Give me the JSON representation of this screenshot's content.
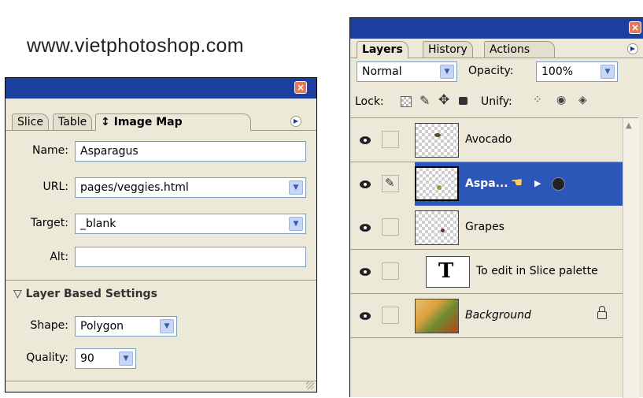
{
  "caption": "www.vietphotoshop.com",
  "image_map_panel": {
    "tabs": [
      "Slice",
      "Table",
      "↕ Image Map"
    ],
    "fields": {
      "name_label": "Name:",
      "name_value": "Asparagus",
      "url_label": "URL:",
      "url_value": "pages/veggies.html",
      "target_label": "Target:",
      "target_value": "_blank",
      "alt_label": "Alt:",
      "alt_value": ""
    },
    "section_title": "▽ Layer Based Settings",
    "shape_label": "Shape:",
    "shape_value": "Polygon",
    "quality_label": "Quality:",
    "quality_value": "90"
  },
  "layers_panel": {
    "tabs": [
      "Layers",
      "History",
      "Actions"
    ],
    "blend_mode": "Normal",
    "opacity_label": "Opacity:",
    "opacity_value": "100%",
    "lock_label": "Lock:",
    "unify_label": "Unify:",
    "layers": [
      {
        "name": "Avocado",
        "selected": false
      },
      {
        "name": "Aspa...",
        "selected": true
      },
      {
        "name": "Grapes",
        "selected": false
      },
      {
        "name": "To edit in Slice palette",
        "selected": false,
        "type": "text"
      },
      {
        "name": "Background",
        "selected": false,
        "locked": true
      }
    ],
    "text_layer_glyph": "T"
  },
  "colors": {
    "titlebar": "#1a3f9e",
    "panel_bg": "#ece9d8",
    "selection": "#2c57b8"
  }
}
